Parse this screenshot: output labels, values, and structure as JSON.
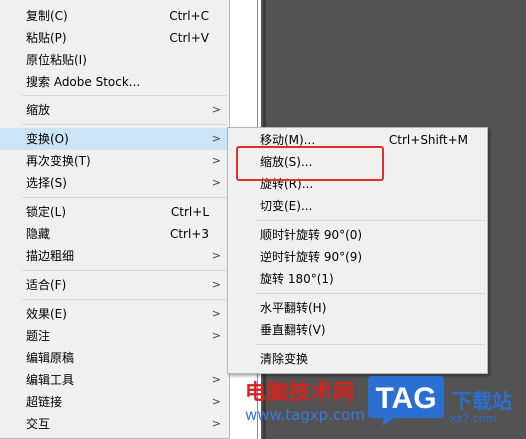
{
  "main_menu": {
    "items": [
      {
        "label": "复制(C)",
        "shortcut": "Ctrl+C",
        "submenu": false
      },
      {
        "label": "粘贴(P)",
        "shortcut": "Ctrl+V",
        "submenu": false
      },
      {
        "label": "原位粘贴(I)",
        "shortcut": "",
        "submenu": false
      },
      {
        "label": "搜索 Adobe Stock...",
        "shortcut": "",
        "submenu": false
      },
      {
        "label": "缩放",
        "shortcut": "",
        "submenu": true
      },
      {
        "label": "变换(O)",
        "shortcut": "",
        "submenu": true,
        "highlighted": true
      },
      {
        "label": "再次变换(T)",
        "shortcut": "",
        "submenu": true
      },
      {
        "label": "选择(S)",
        "shortcut": "",
        "submenu": true
      },
      {
        "label": "锁定(L)",
        "shortcut": "Ctrl+L",
        "submenu": false
      },
      {
        "label": "隐藏",
        "shortcut": "Ctrl+3",
        "submenu": false
      },
      {
        "label": "描边粗细",
        "shortcut": "",
        "submenu": true
      },
      {
        "label": "适合(F)",
        "shortcut": "",
        "submenu": true
      },
      {
        "label": "效果(E)",
        "shortcut": "",
        "submenu": true
      },
      {
        "label": "题注",
        "shortcut": "",
        "submenu": true
      },
      {
        "label": "编辑原稿",
        "shortcut": "",
        "submenu": false
      },
      {
        "label": "编辑工具",
        "shortcut": "",
        "submenu": true
      },
      {
        "label": "超链接",
        "shortcut": "",
        "submenu": true
      },
      {
        "label": "交互",
        "shortcut": "",
        "submenu": true
      }
    ]
  },
  "sub_menu": {
    "items": [
      {
        "label": "移动(M)...",
        "shortcut": "Ctrl+Shift+M"
      },
      {
        "label": "缩放(S)...",
        "shortcut": "",
        "highlighted_box": true
      },
      {
        "label": "旋转(R)...",
        "shortcut": ""
      },
      {
        "label": "切变(E)...",
        "shortcut": ""
      },
      {
        "label": "顺时针旋转 90°(0)",
        "shortcut": ""
      },
      {
        "label": "逆时针旋转 90°(9)",
        "shortcut": ""
      },
      {
        "label": "旋转 180°(1)",
        "shortcut": ""
      },
      {
        "label": "水平翻转(H)",
        "shortcut": ""
      },
      {
        "label": "垂直翻转(V)",
        "shortcut": ""
      },
      {
        "label": "清除变换",
        "shortcut": ""
      }
    ]
  },
  "watermark": {
    "site_name": "电脑技术网",
    "url": "www.tagxp.com",
    "logo_text": "TAG",
    "download_text": "下载站",
    "domain": "xz7.com"
  },
  "colors": {
    "menu_bg": "#f0f0f0",
    "highlight": "#cce4f7",
    "annotation_red": "#e0302c",
    "canvas_dark": "#535353"
  },
  "icons": {
    "submenu_arrow": "chevron-right-icon"
  }
}
